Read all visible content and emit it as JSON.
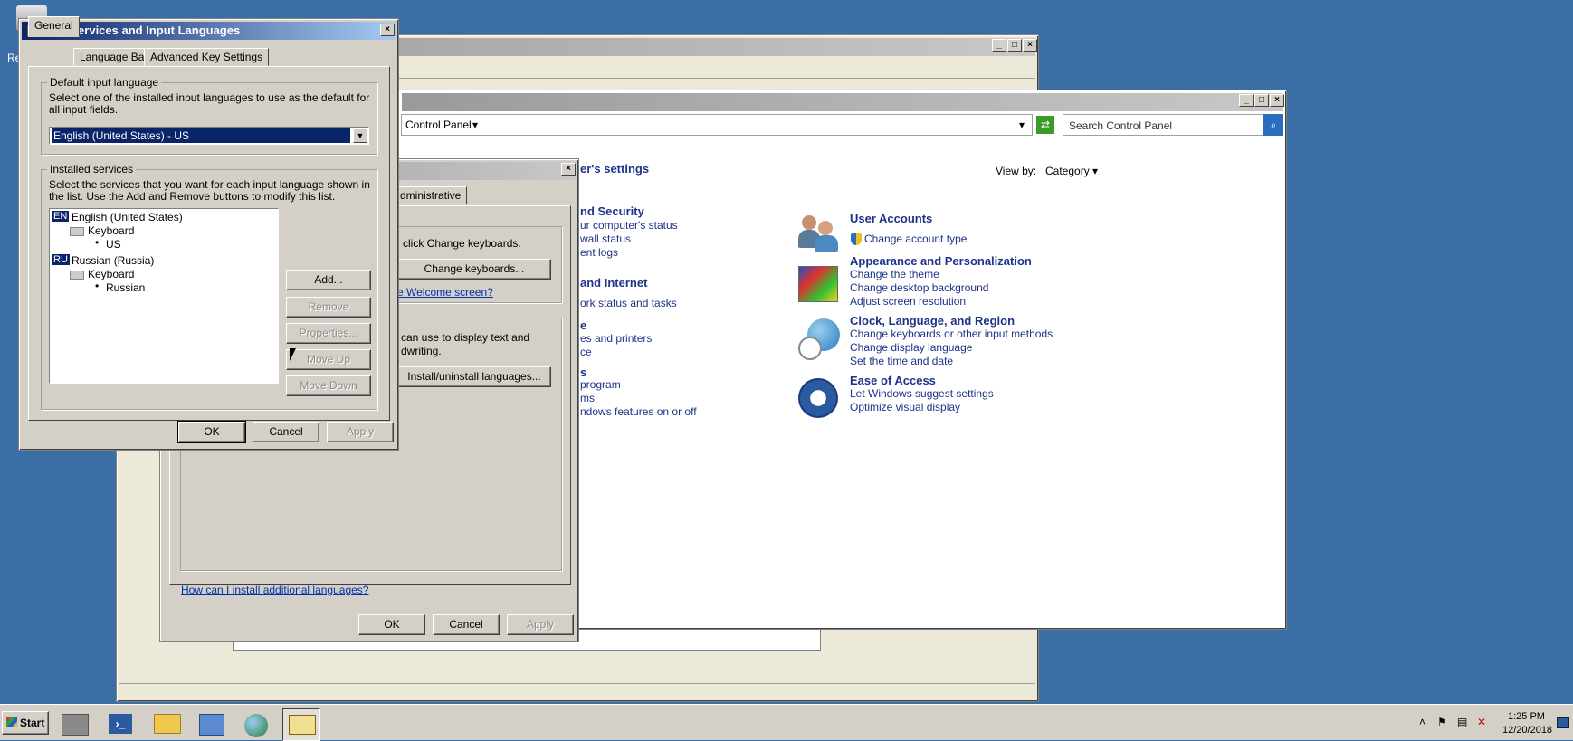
{
  "desktop": {
    "recycle_label": "Re"
  },
  "cpanel": {
    "breadcrumb": "Control Panel",
    "search_placeholder": "Search Control Panel",
    "heading": "er's settings",
    "view_by_label": "View by:",
    "view_by_value": "Category",
    "left_items": [
      {
        "text": "nd Security",
        "bold": true
      },
      {
        "text": "ur computer's status"
      },
      {
        "text": "wall status"
      },
      {
        "text": "ent logs"
      },
      {
        "text": "and Internet",
        "bold": true
      },
      {
        "text": "ork status and tasks"
      },
      {
        "text": "e",
        "bold": true
      },
      {
        "text": "es and printers"
      },
      {
        "text": "ce"
      },
      {
        "text": "s",
        "bold": true
      },
      {
        "text": "program"
      },
      {
        "text": "ms"
      },
      {
        "text": "ndows features on or off"
      }
    ],
    "categories": [
      {
        "title": "User Accounts",
        "links": [
          "Change account type"
        ]
      },
      {
        "title": "Appearance and Personalization",
        "links": [
          "Change the theme",
          "Change desktop background",
          "Adjust screen resolution"
        ]
      },
      {
        "title": "Clock, Language, and Region",
        "links": [
          "Change keyboards or other input methods",
          "Change display language",
          "Set the time and date"
        ]
      },
      {
        "title": "Ease of Access",
        "links": [
          "Let Windows suggest settings",
          "Optimize visual display"
        ]
      }
    ]
  },
  "region": {
    "tab_admin": "dministrative",
    "kb_text": "click Change keyboards.",
    "change_keyboards": "Change keyboards...",
    "welcome_link": "e Welcome screen?",
    "display_text_1": "can use to display text and",
    "display_text_2": "dwriting.",
    "install_btn": "Install/uninstall languages...",
    "how_link": "How can I install additional languages?",
    "ok": "OK",
    "cancel": "Cancel",
    "apply": "Apply"
  },
  "tsil": {
    "title": "Text Services and Input Languages",
    "tabs": [
      "General",
      "Language Bar",
      "Advanced Key Settings"
    ],
    "default_group": "Default input language",
    "default_desc": "Select one of the installed input languages to use as the default for all input fields.",
    "default_value": "English (United States) - US",
    "installed_group": "Installed services",
    "installed_desc": "Select the services that you want for each input language shown in the list. Use the Add and Remove buttons to modify this list.",
    "tree": {
      "lang1_code": "EN",
      "lang1": "English (United States)",
      "kb1": "Keyboard",
      "layout1": "US",
      "lang2_code": "RU",
      "lang2": "Russian (Russia)",
      "kb2": "Keyboard",
      "layout2": "Russian"
    },
    "buttons": {
      "add": "Add...",
      "remove": "Remove",
      "properties": "Properties...",
      "move_up": "Move Up",
      "move_down": "Move Down"
    },
    "ok": "OK",
    "cancel": "Cancel",
    "apply": "Apply"
  },
  "taskbar": {
    "start": "Start",
    "time": "1:25 PM",
    "date": "12/20/2018"
  }
}
